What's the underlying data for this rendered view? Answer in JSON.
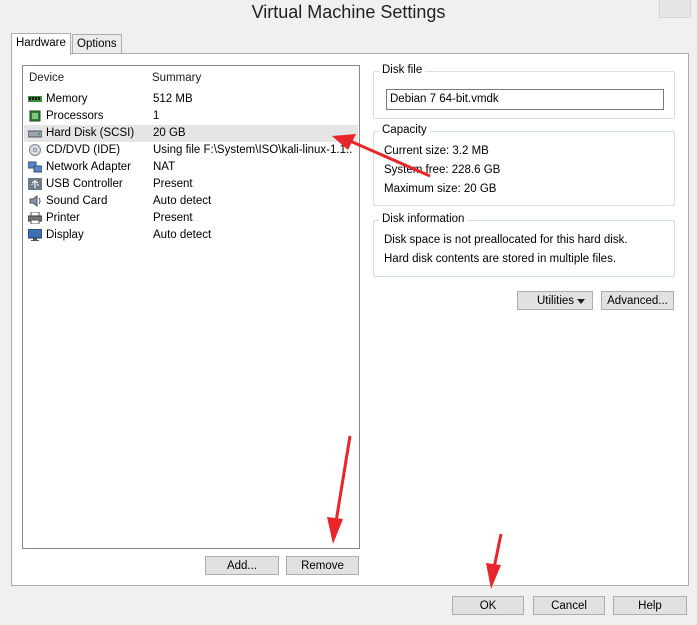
{
  "window": {
    "title": "Virtual Machine Settings"
  },
  "tabs": [
    {
      "label": "Hardware",
      "active": true
    },
    {
      "label": "Options",
      "active": false
    }
  ],
  "device_list": {
    "columns": {
      "device": "Device",
      "summary": "Summary"
    },
    "rows": [
      {
        "icon": "memory-icon",
        "device": "Memory",
        "summary": "512 MB",
        "selected": false
      },
      {
        "icon": "processor-icon",
        "device": "Processors",
        "summary": "1",
        "selected": false
      },
      {
        "icon": "hard-disk-icon",
        "device": "Hard Disk (SCSI)",
        "summary": "20 GB",
        "selected": true
      },
      {
        "icon": "cd-dvd-icon",
        "device": "CD/DVD (IDE)",
        "summary": "Using file F:\\System\\ISO\\kali-linux-1.1....",
        "selected": false
      },
      {
        "icon": "network-adapter-icon",
        "device": "Network Adapter",
        "summary": "NAT",
        "selected": false
      },
      {
        "icon": "usb-icon",
        "device": "USB Controller",
        "summary": "Present",
        "selected": false
      },
      {
        "icon": "sound-card-icon",
        "device": "Sound Card",
        "summary": "Auto detect",
        "selected": false
      },
      {
        "icon": "printer-icon",
        "device": "Printer",
        "summary": "Present",
        "selected": false
      },
      {
        "icon": "display-icon",
        "device": "Display",
        "summary": "Auto detect",
        "selected": false
      }
    ]
  },
  "list_buttons": {
    "add": "Add...",
    "remove": "Remove"
  },
  "disk_file": {
    "title": "Disk file",
    "value": "Debian 7 64-bit.vmdk"
  },
  "capacity": {
    "title": "Capacity",
    "current": "Current size: 3.2 MB",
    "system_free": "System free: 228.6 GB",
    "maximum": "Maximum size: 20 GB"
  },
  "disk_info": {
    "title": "Disk information",
    "line1": "Disk space is not preallocated for this hard disk.",
    "line2": "Hard disk contents are stored in multiple files."
  },
  "disk_buttons": {
    "utilities": "Utilities",
    "advanced": "Advanced..."
  },
  "dialog_buttons": {
    "ok": "OK",
    "cancel": "Cancel",
    "help": "Help"
  },
  "annotation_color": "#e8262a"
}
